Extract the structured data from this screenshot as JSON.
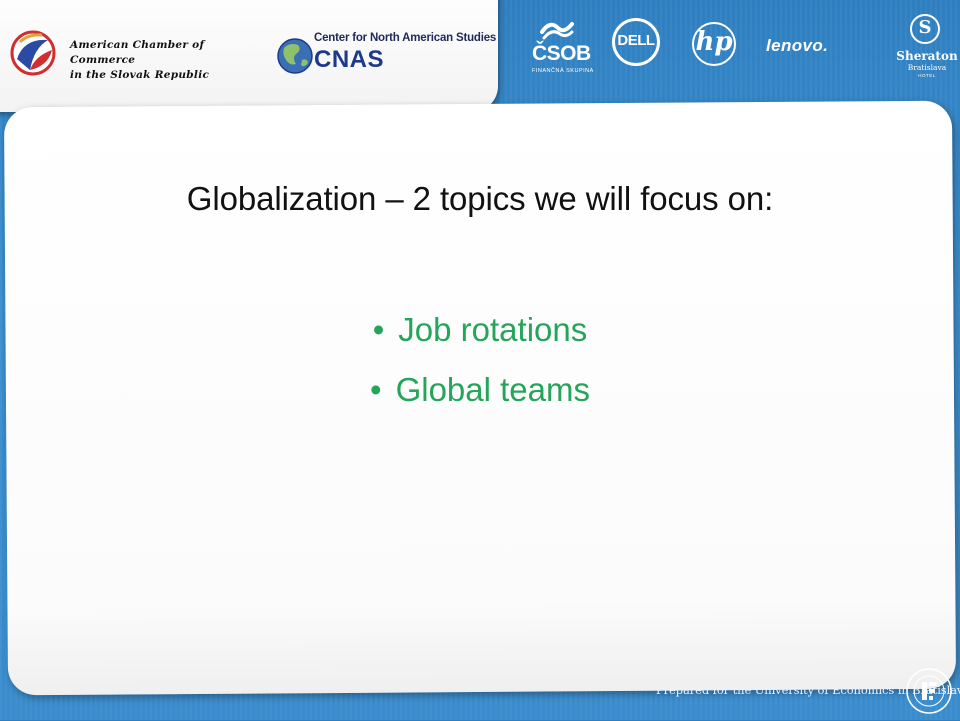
{
  "header": {
    "amcham": {
      "line1": "American Chamber of Commerce",
      "line2": "in the Slovak Republic"
    },
    "cnas": {
      "top": "Center for North American Studies",
      "big": "CNAS"
    }
  },
  "sponsors": {
    "csob": {
      "name": "ČSOB",
      "tagline": "FINANČNÁ SKUPINA"
    },
    "dell": "DELL",
    "hp": "hp",
    "lenovo": "lenovo.",
    "sheraton": {
      "name": "Sheraton",
      "city": "Bratislava",
      "hotel": "HOTEL"
    }
  },
  "slide": {
    "title": "Globalization – 2 topics we will focus on:",
    "bullet_char": "•",
    "bullets": [
      {
        "text": "Job rotations"
      },
      {
        "text": "Global teams"
      }
    ],
    "bullet_color": "#25a55a"
  },
  "footer": {
    "text": "Prepared for the University of Economics in Bratislava"
  },
  "colors": {
    "background": "#3a8ccd",
    "title": "#111111",
    "accent_green": "#25a55a"
  }
}
